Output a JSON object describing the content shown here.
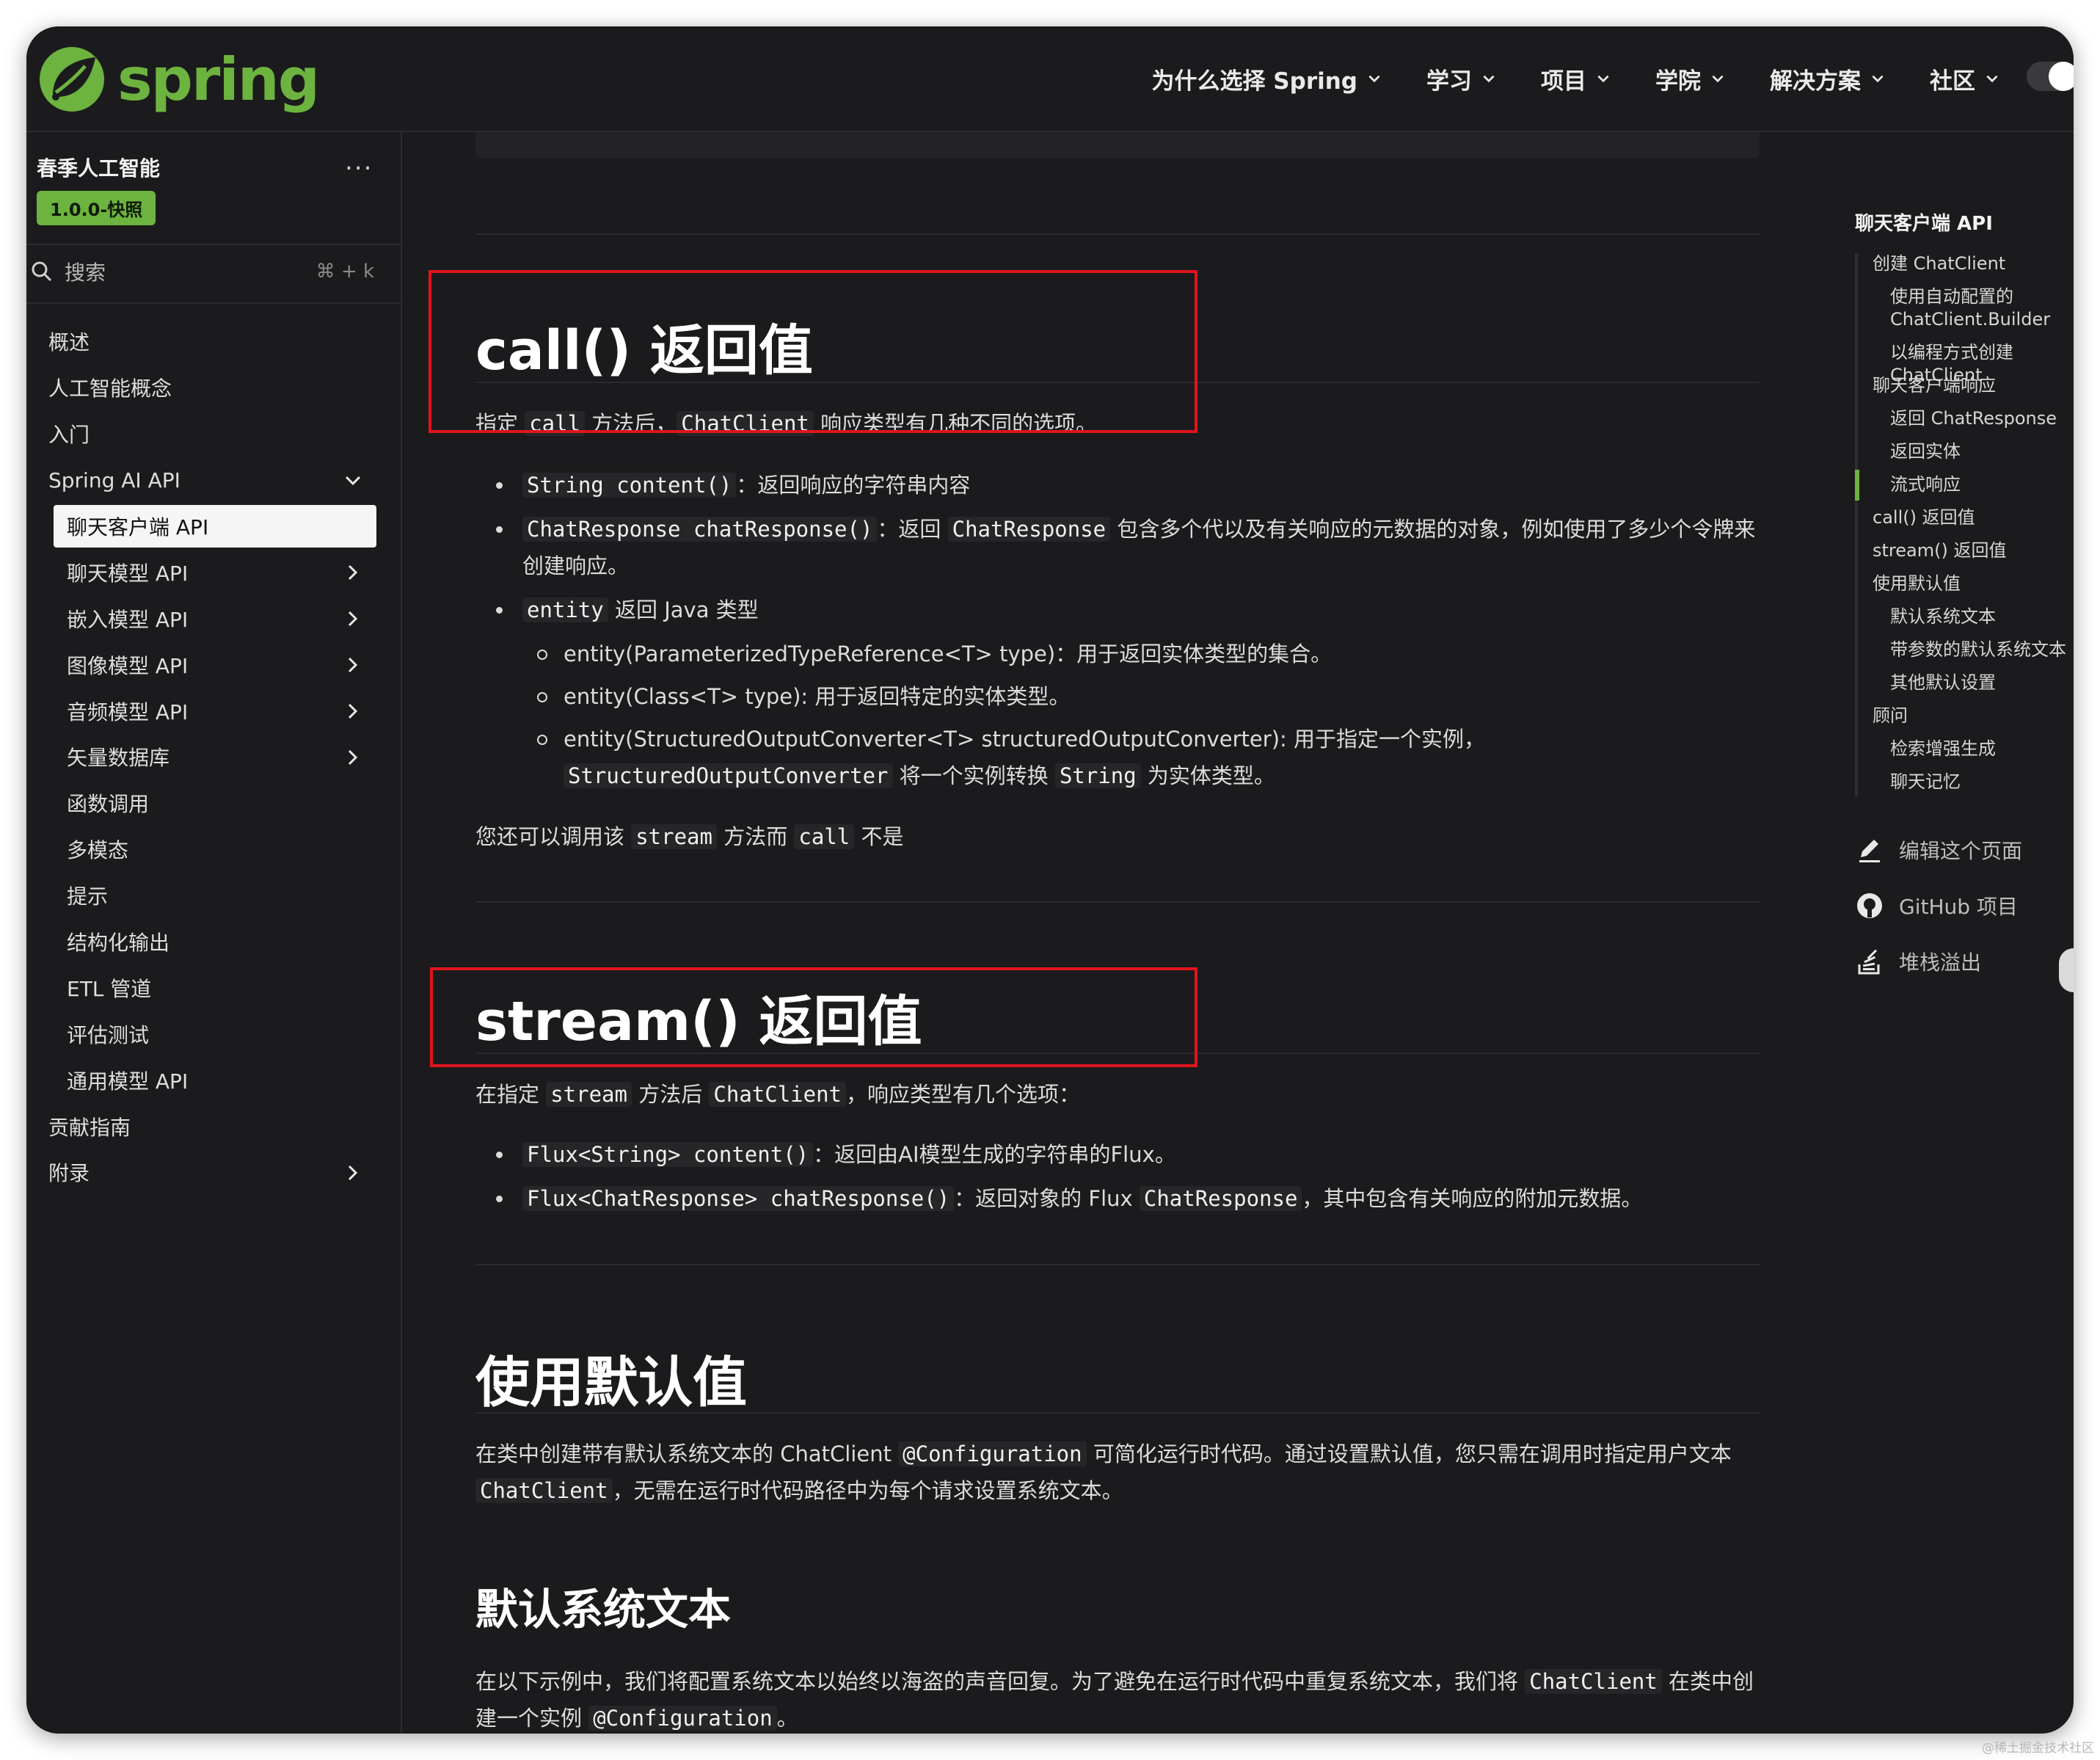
{
  "header": {
    "logo_text": "spring",
    "nav": [
      {
        "label": "为什么选择 Spring"
      },
      {
        "label": "学习"
      },
      {
        "label": "项目"
      },
      {
        "label": "学院"
      },
      {
        "label": "解决方案"
      },
      {
        "label": "社区"
      }
    ]
  },
  "sidebar": {
    "title": "春季人工智能",
    "more": "...",
    "version_badge": "1.0.0-快照",
    "search_label": "搜索",
    "search_shortcut": "⌘ + k",
    "items": [
      {
        "label": "概述",
        "level": 0,
        "chevron": "none"
      },
      {
        "label": "人工智能概念",
        "level": 0,
        "chevron": "none"
      },
      {
        "label": "入门",
        "level": 0,
        "chevron": "none"
      },
      {
        "label": "Spring AI API",
        "level": 0,
        "chevron": "down"
      },
      {
        "label": "聊天客户端 API",
        "level": 1,
        "chevron": "none",
        "active": true
      },
      {
        "label": "聊天模型 API",
        "level": 1,
        "chevron": "right"
      },
      {
        "label": "嵌入模型 API",
        "level": 1,
        "chevron": "right"
      },
      {
        "label": "图像模型 API",
        "level": 1,
        "chevron": "right"
      },
      {
        "label": "音频模型 API",
        "level": 1,
        "chevron": "right"
      },
      {
        "label": "矢量数据库",
        "level": 1,
        "chevron": "right"
      },
      {
        "label": "函数调用",
        "level": 1,
        "chevron": "none"
      },
      {
        "label": "多模态",
        "level": 1,
        "chevron": "none"
      },
      {
        "label": "提示",
        "level": 1,
        "chevron": "none"
      },
      {
        "label": "结构化输出",
        "level": 1,
        "chevron": "none"
      },
      {
        "label": "ETL 管道",
        "level": 1,
        "chevron": "none"
      },
      {
        "label": "评估测试",
        "level": 1,
        "chevron": "none"
      },
      {
        "label": "通用模型 API",
        "level": 1,
        "chevron": "none"
      },
      {
        "label": "贡献指南",
        "level": 0,
        "chevron": "none"
      },
      {
        "label": "附录",
        "level": 0,
        "chevron": "right"
      }
    ]
  },
  "content": {
    "call_heading": "call() 返回值",
    "call_intro": {
      "t1": "指定 ",
      "c1": "call",
      "t2": " 方法后，",
      "c2": "ChatClient",
      "t3": " 响应类型有几种不同的选项。"
    },
    "call_items": [
      {
        "code": "String content()",
        "text": "：返回响应的字符串内容"
      },
      {
        "code": "ChatResponse chatResponse()",
        "text1": "：返回 ",
        "code2": "ChatResponse",
        "text2": " 包含多个代以及有关响应的元数据的对象，例如使用了多少个令牌来创建响应。"
      },
      {
        "code": "entity",
        "text": " 返回 Java 类型"
      }
    ],
    "entity_items": [
      {
        "text": "entity(ParameterizedTypeReference<T> type)：用于返回实体类型的集合。"
      },
      {
        "text": "entity(Class<T> type): 用于返回特定的实体类型。"
      },
      {
        "text": "entity(StructuredOutputConverter<T> structuredOutputConverter): 用于指定一个实例，",
        "code": "StructuredOutputConverter",
        "text2": " 将一个实例转换 ",
        "code2": "String",
        "text3": " 为实体类型。"
      }
    ],
    "stream_note": {
      "t1": "您还可以调用该 ",
      "c1": "stream",
      "t2": " 方法而 ",
      "c2": "call",
      "t3": " 不是"
    },
    "stream_heading": "stream() 返回值",
    "stream_intro": {
      "t1": "在指定 ",
      "c1": "stream",
      "t2": " 方法后 ",
      "c2": "ChatClient",
      "t3": "，响应类型有几个选项："
    },
    "stream_items": [
      {
        "code": "Flux<String> content()",
        "text": "：返回由AI模型生成的字符串的Flux。"
      },
      {
        "code": "Flux<ChatResponse> chatResponse()",
        "text1": "：返回对象的 Flux ",
        "code2": "ChatResponse",
        "text2": "，其中包含有关响应的附加元数据。"
      }
    ],
    "defaults_heading": "使用默认值",
    "defaults_para": {
      "t1": "在类中创建带有默认系统文本的 ChatClient ",
      "c1": "@Configuration",
      "t2": " 可简化运行时代码。通过设置默认值，您只需在调用时指定用户文本 ",
      "c2": "ChatClient",
      "t3": "，无需在运行时代码路径中为每个请求设置系统文本。"
    },
    "sys_heading": "默认系统文本",
    "sys_para": {
      "t1": "在以下示例中，我们将配置系统文本以始终以海盗的声音回复。为了避免在运行时代码中重复系统文本，我们将 ",
      "c1": "ChatClient",
      "t2": " 在类中创建一个实例 ",
      "c2": "@Configuration",
      "t3": "。"
    }
  },
  "toc": {
    "title": "聊天客户端 API",
    "items": [
      {
        "label": "创建 ChatClient",
        "level": 1
      },
      {
        "label": "使用自动配置的 ChatClient.Builder",
        "level": 2
      },
      {
        "label": "以编程方式创建 ChatClient",
        "level": 2
      },
      {
        "label": "聊天客户端响应",
        "level": 1
      },
      {
        "label": "返回 ChatResponse",
        "level": 2
      },
      {
        "label": "返回实体",
        "level": 2
      },
      {
        "label": "流式响应",
        "level": 2,
        "active": true
      },
      {
        "label": "call() 返回值",
        "level": 1
      },
      {
        "label": "stream() 返回值",
        "level": 1
      },
      {
        "label": "使用默认值",
        "level": 1
      },
      {
        "label": "默认系统文本",
        "level": 2
      },
      {
        "label": "带参数的默认系统文本",
        "level": 2
      },
      {
        "label": "其他默认设置",
        "level": 2
      },
      {
        "label": "顾问",
        "level": 1
      },
      {
        "label": "检索增强生成",
        "level": 2
      },
      {
        "label": "聊天记忆",
        "level": 2
      }
    ],
    "links": [
      {
        "label": "编辑这个页面",
        "icon": "pencil-icon"
      },
      {
        "label": "GitHub 项目",
        "icon": "github-icon"
      },
      {
        "label": "堆栈溢出",
        "icon": "stackoverflow-icon"
      }
    ]
  },
  "watermark": "@稀土掘金技术社区",
  "colors": {
    "accent": "#6db33f",
    "highlight": "#e0141e",
    "background": "#1b1b1d"
  }
}
